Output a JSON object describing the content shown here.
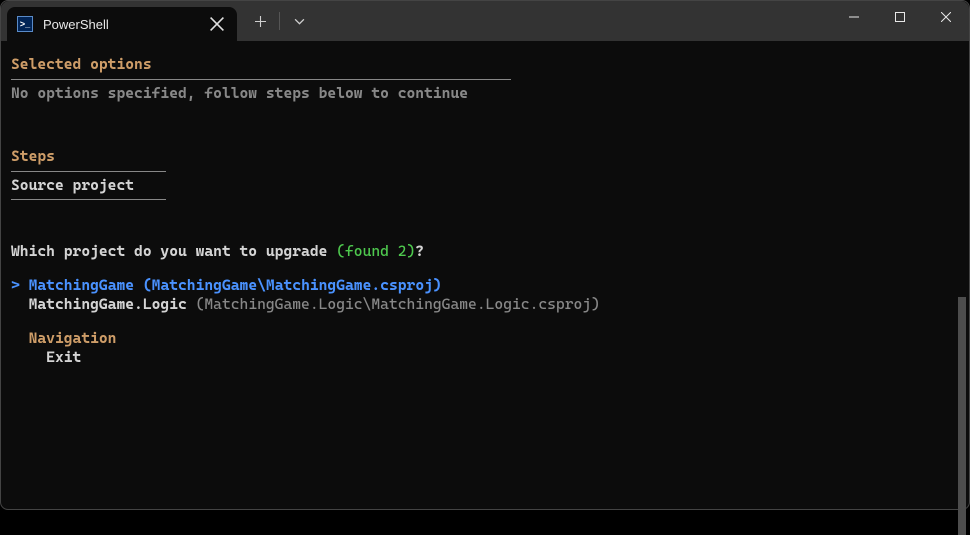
{
  "titlebar": {
    "tab_title": "PowerShell",
    "tab_icon_text": ">_"
  },
  "sections": {
    "selected_options": {
      "title": "Selected options",
      "body": "No options specified, follow steps below to continue"
    },
    "steps": {
      "title": "Steps",
      "body": "Source project"
    }
  },
  "prompt": {
    "question_prefix": "Which project do you want to upgrade ",
    "found_text": "(found 2)",
    "question_suffix": "?"
  },
  "options": {
    "selected_marker": ">",
    "selected_name": "MatchingGame",
    "selected_path": "(MatchingGame\\MatchingGame.csproj)",
    "other_name": "MatchingGame.Logic",
    "other_path": "(MatchingGame.Logic\\MatchingGame.Logic.csproj)"
  },
  "nav": {
    "header": "Navigation",
    "exit": "Exit"
  }
}
